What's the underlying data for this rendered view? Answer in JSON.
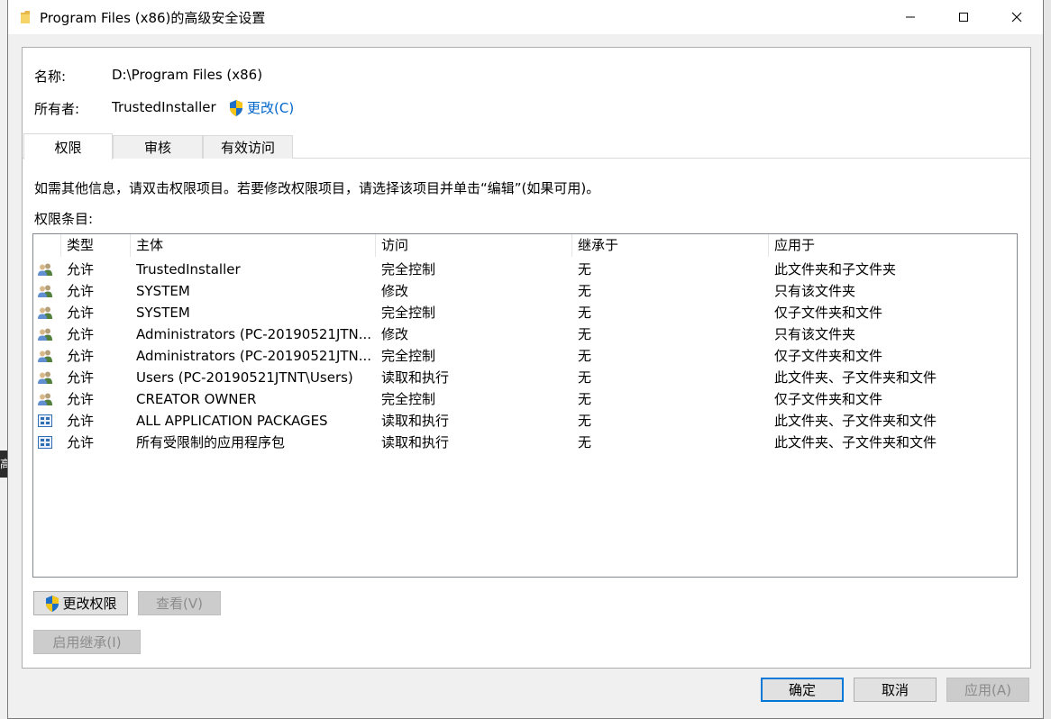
{
  "window": {
    "title": "Program Files (x86)的高级安全设置"
  },
  "info": {
    "name_label": "名称:",
    "name_value": "D:\\Program Files (x86)",
    "owner_label": "所有者:",
    "owner_value": "TrustedInstaller",
    "change_owner_link": "更改(C)"
  },
  "tabs": [
    {
      "label": "权限",
      "active": true
    },
    {
      "label": "审核",
      "active": false
    },
    {
      "label": "有效访问",
      "active": false
    }
  ],
  "instructions": "如需其他信息，请双击权限项目。若要修改权限项目，请选择该项目并单击“编辑”(如果可用)。",
  "entries_label": "权限条目:",
  "columns": [
    "类型",
    "主体",
    "访问",
    "继承于",
    "应用于"
  ],
  "rows": [
    {
      "icon": "user-group-icon",
      "type": "允许",
      "principal": "TrustedInstaller",
      "access": "完全控制",
      "inherited": "无",
      "applies": "此文件夹和子文件夹"
    },
    {
      "icon": "user-group-icon",
      "type": "允许",
      "principal": "SYSTEM",
      "access": "修改",
      "inherited": "无",
      "applies": "只有该文件夹"
    },
    {
      "icon": "user-group-icon",
      "type": "允许",
      "principal": "SYSTEM",
      "access": "完全控制",
      "inherited": "无",
      "applies": "仅子文件夹和文件"
    },
    {
      "icon": "user-group-icon",
      "type": "允许",
      "principal": "Administrators (PC-20190521JTN...",
      "access": "修改",
      "inherited": "无",
      "applies": "只有该文件夹"
    },
    {
      "icon": "user-group-icon",
      "type": "允许",
      "principal": "Administrators (PC-20190521JTN...",
      "access": "完全控制",
      "inherited": "无",
      "applies": "仅子文件夹和文件"
    },
    {
      "icon": "user-group-icon",
      "type": "允许",
      "principal": "Users (PC-20190521JTNT\\Users)",
      "access": "读取和执行",
      "inherited": "无",
      "applies": "此文件夹、子文件夹和文件"
    },
    {
      "icon": "user-group-icon",
      "type": "允许",
      "principal": "CREATOR OWNER",
      "access": "完全控制",
      "inherited": "无",
      "applies": "仅子文件夹和文件"
    },
    {
      "icon": "app-package-icon",
      "type": "允许",
      "principal": "ALL APPLICATION PACKAGES",
      "access": "读取和执行",
      "inherited": "无",
      "applies": "此文件夹、子文件夹和文件"
    },
    {
      "icon": "app-package-icon",
      "type": "允许",
      "principal": "所有受限制的应用程序包",
      "access": "读取和执行",
      "inherited": "无",
      "applies": "此文件夹、子文件夹和文件"
    }
  ],
  "buttons": {
    "change_permissions": "更改权限",
    "view": "查看(V)",
    "enable_inheritance": "启用继承(I)",
    "ok": "确定",
    "cancel": "取消",
    "apply": "应用(A)"
  },
  "backdrop_fragment": "高",
  "colors": {
    "link": "#0066cc",
    "accent_border": "#0078d7",
    "disabled_text": "#8c8c8c"
  }
}
